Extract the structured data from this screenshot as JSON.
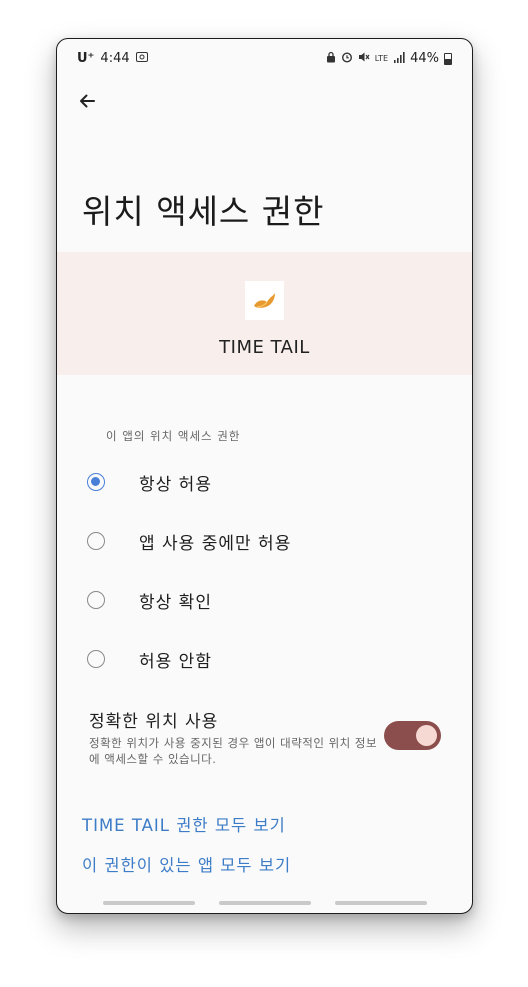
{
  "status_bar": {
    "carrier": "U⁺",
    "time": "4:44",
    "network": "LTE",
    "battery": "44%"
  },
  "page": {
    "title": "위치 액세스 권한"
  },
  "app": {
    "name": "TIME TAIL"
  },
  "section_label": "이 앱의 위치 액세스 권한",
  "options": [
    {
      "label": "항상 허용",
      "selected": true
    },
    {
      "label": "앱 사용 중에만 허용",
      "selected": false
    },
    {
      "label": "항상 확인",
      "selected": false
    },
    {
      "label": "허용 안함",
      "selected": false
    }
  ],
  "precise": {
    "title": "정확한 위치 사용",
    "description": "정확한 위치가 사용 중지된 경우 앱이 대략적인 위치 정보에 액세스할 수 있습니다.",
    "enabled": true
  },
  "links": {
    "all_permissions": "TIME TAIL 권한 모두 보기",
    "all_apps": "이 권한이 있는 앱 모두 보기"
  },
  "colors": {
    "accent": "#4a7fd8",
    "link": "#3d7cc7",
    "toggle_on": "#8b4e4c",
    "band": "#f8efec"
  }
}
